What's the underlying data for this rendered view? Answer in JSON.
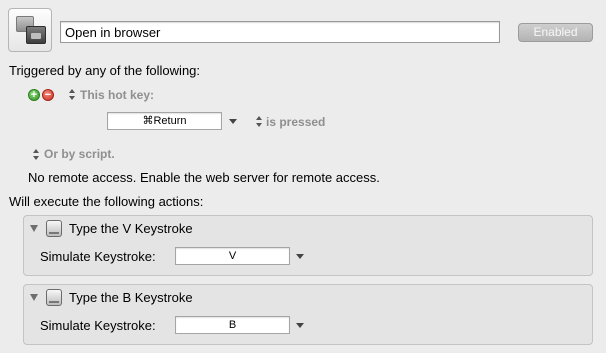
{
  "macro": {
    "name": "Open in browser",
    "enabled_label": "Enabled"
  },
  "trigger": {
    "heading": "Triggered by any of the following:",
    "add_symbol": "+",
    "remove_symbol": "−",
    "hotkey_label": "This hot key:",
    "hotkey_value": "⌘Return",
    "hotkey_condition": "is pressed",
    "script_label": "Or by script.",
    "remote_note": "No remote access.  Enable the web server for remote access."
  },
  "actions": {
    "heading": "Will execute the following actions:",
    "items": [
      {
        "title": "Type the V Keystroke",
        "field_label": "Simulate Keystroke:",
        "keystroke": "V"
      },
      {
        "title": "Type the B Keystroke",
        "field_label": "Simulate Keystroke:",
        "keystroke": "B"
      }
    ]
  },
  "icons": {
    "macro": "macro-group-icon",
    "add": "add-icon",
    "remove": "remove-icon",
    "keyboard": "keyboard-icon"
  },
  "colors": {
    "background": "#ececec",
    "add_green": "#2f9a21",
    "remove_red": "#cc2b1e",
    "secondary_text": "#8f8f8f"
  }
}
